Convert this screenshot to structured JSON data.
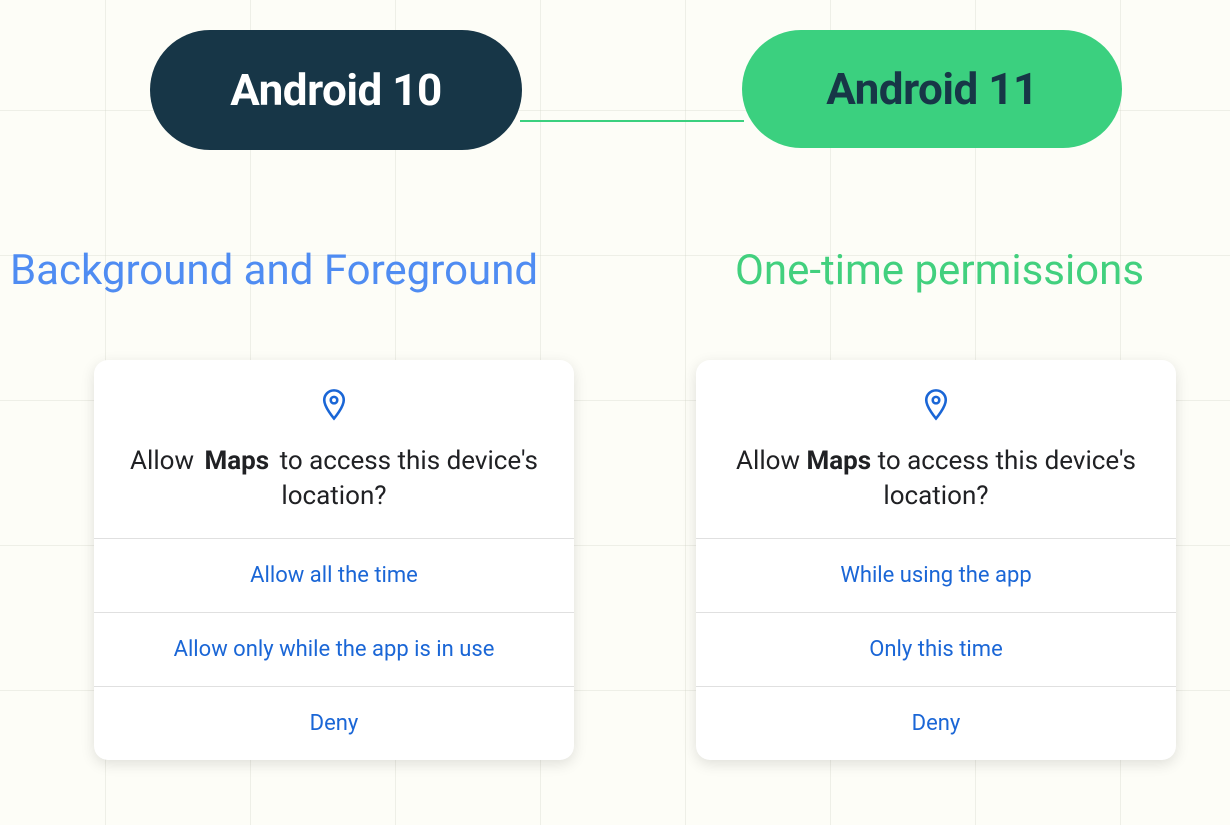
{
  "pills": {
    "left_label": "Android 10",
    "right_label": "Android 11"
  },
  "sections": {
    "left_heading": "Background and Foreground",
    "right_heading": "One-time permissions"
  },
  "left_card": {
    "prompt_pre": "Allow ",
    "prompt_app": "Maps",
    "prompt_post": " to access this device's location?",
    "options": {
      "o0": "Allow all the time",
      "o1": "Allow only while the app is in use",
      "o2": "Deny"
    }
  },
  "right_card": {
    "prompt_pre": "Allow ",
    "prompt_app": "Maps",
    "prompt_post": " to access this device's location?",
    "options": {
      "o0": "While using the app",
      "o1": "Only this time",
      "o2": "Deny"
    }
  },
  "colors": {
    "blue": "#4f8cf2",
    "green": "#3bd07f",
    "dark": "#173647",
    "link": "#1a66d6"
  }
}
